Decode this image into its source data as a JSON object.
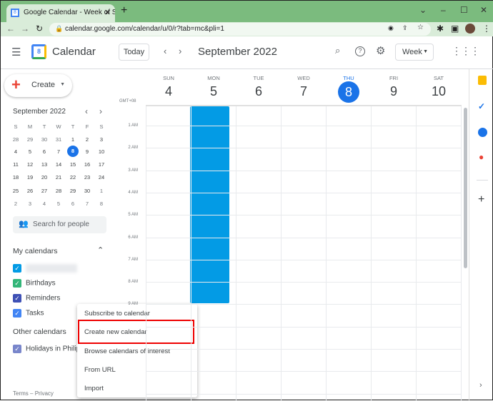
{
  "browser": {
    "tab_title": "Google Calendar - Week of Septe",
    "url": "calendar.google.com/calendar/u/0/r?tab=mc&pli=1"
  },
  "header": {
    "app_name": "Calendar",
    "logo_day": "8",
    "today_label": "Today",
    "title": "September 2022",
    "view_label": "Week"
  },
  "create": {
    "label": "Create"
  },
  "mini_calendar": {
    "title": "September 2022",
    "weekdays": [
      "S",
      "M",
      "T",
      "W",
      "T",
      "F",
      "S"
    ],
    "weeks": [
      [
        "28",
        "29",
        "30",
        "31",
        "1",
        "2",
        "3"
      ],
      [
        "4",
        "5",
        "6",
        "7",
        "8",
        "9",
        "10"
      ],
      [
        "11",
        "12",
        "13",
        "14",
        "15",
        "16",
        "17"
      ],
      [
        "18",
        "19",
        "20",
        "21",
        "22",
        "23",
        "24"
      ],
      [
        "25",
        "26",
        "27",
        "28",
        "29",
        "30",
        "1"
      ],
      [
        "2",
        "3",
        "4",
        "5",
        "6",
        "7",
        "8"
      ]
    ],
    "selected": "8"
  },
  "search_people": {
    "placeholder": "Search for people"
  },
  "my_calendars": {
    "title": "My calendars",
    "items": [
      {
        "label": "",
        "color": "#039be5"
      },
      {
        "label": "Birthdays",
        "color": "#33b679"
      },
      {
        "label": "Reminders",
        "color": "#3f51b5"
      },
      {
        "label": "Tasks",
        "color": "#4285f4"
      }
    ]
  },
  "other_calendars": {
    "title": "Other calendars",
    "items": [
      {
        "label": "Holidays in Philipp",
        "color": "#7986cb"
      }
    ]
  },
  "footer": {
    "terms": "Terms",
    "sep": "–",
    "privacy": "Privacy"
  },
  "week": {
    "timezone": "GMT+08",
    "days": [
      {
        "dow": "SUN",
        "num": "4"
      },
      {
        "dow": "MON",
        "num": "5"
      },
      {
        "dow": "TUE",
        "num": "6"
      },
      {
        "dow": "WED",
        "num": "7"
      },
      {
        "dow": "THU",
        "num": "8",
        "today": true
      },
      {
        "dow": "FRI",
        "num": "9"
      },
      {
        "dow": "SAT",
        "num": "10"
      }
    ],
    "hours": [
      "1 AM",
      "2 AM",
      "3 AM",
      "4 AM",
      "5 AM",
      "6 AM",
      "7 AM",
      "8 AM",
      "9 AM"
    ],
    "event_color": "#039be5",
    "today_color": "#1a73e8"
  },
  "menu": {
    "items": [
      "Subscribe to calendar",
      "Create new calendar",
      "Browse calendars of interest",
      "From URL",
      "Import"
    ],
    "highlighted": "Create new calendar"
  }
}
